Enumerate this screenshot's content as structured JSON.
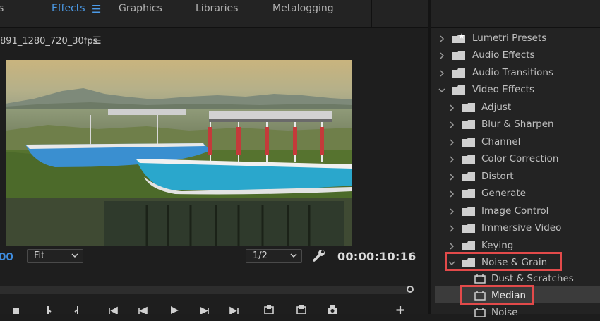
{
  "workspace_tabs": [
    {
      "label": "s",
      "active": false
    },
    {
      "label": "Effects",
      "active": true
    },
    {
      "label": "Graphics",
      "active": false
    },
    {
      "label": "Libraries",
      "active": false
    },
    {
      "label": "Metalogging",
      "active": false
    }
  ],
  "monitor": {
    "title": "891_1280_720_30fps",
    "timecode_left": "00",
    "fit_value": "Fit",
    "resolution_value": "1/2",
    "timecode_right": "00:00:10:16"
  },
  "effects_panel": {
    "items": [
      {
        "label": "Lumetri Presets",
        "level": 0,
        "expanded": false,
        "icon": "star-folder-icon"
      },
      {
        "label": "Audio Effects",
        "level": 0,
        "expanded": false,
        "icon": "folder-icon"
      },
      {
        "label": "Audio Transitions",
        "level": 0,
        "expanded": false,
        "icon": "folder-icon"
      },
      {
        "label": "Video Effects",
        "level": 0,
        "expanded": true,
        "icon": "folder-icon"
      },
      {
        "label": "Adjust",
        "level": 1,
        "expanded": false,
        "icon": "folder-icon"
      },
      {
        "label": "Blur & Sharpen",
        "level": 1,
        "expanded": false,
        "icon": "folder-icon"
      },
      {
        "label": "Channel",
        "level": 1,
        "expanded": false,
        "icon": "folder-icon"
      },
      {
        "label": "Color Correction",
        "level": 1,
        "expanded": false,
        "icon": "folder-icon"
      },
      {
        "label": "Distort",
        "level": 1,
        "expanded": false,
        "icon": "folder-icon"
      },
      {
        "label": "Generate",
        "level": 1,
        "expanded": false,
        "icon": "folder-icon"
      },
      {
        "label": "Image Control",
        "level": 1,
        "expanded": false,
        "icon": "folder-icon"
      },
      {
        "label": "Immersive Video",
        "level": 1,
        "expanded": false,
        "icon": "folder-icon"
      },
      {
        "label": "Keying",
        "level": 1,
        "expanded": false,
        "icon": "folder-icon"
      },
      {
        "label": "Noise & Grain",
        "level": 1,
        "expanded": true,
        "icon": "folder-icon",
        "highlighted": true
      },
      {
        "label": "Dust & Scratches",
        "level": 2,
        "icon": "effect-icon"
      },
      {
        "label": "Median",
        "level": 2,
        "icon": "effect-icon",
        "selected": true,
        "highlighted": true
      },
      {
        "label": "Noise",
        "level": 2,
        "icon": "effect-icon"
      }
    ]
  },
  "colors": {
    "accent": "#4c9be8",
    "highlight_box": "#e24a4a",
    "selected_row": "#3b3b3b"
  }
}
